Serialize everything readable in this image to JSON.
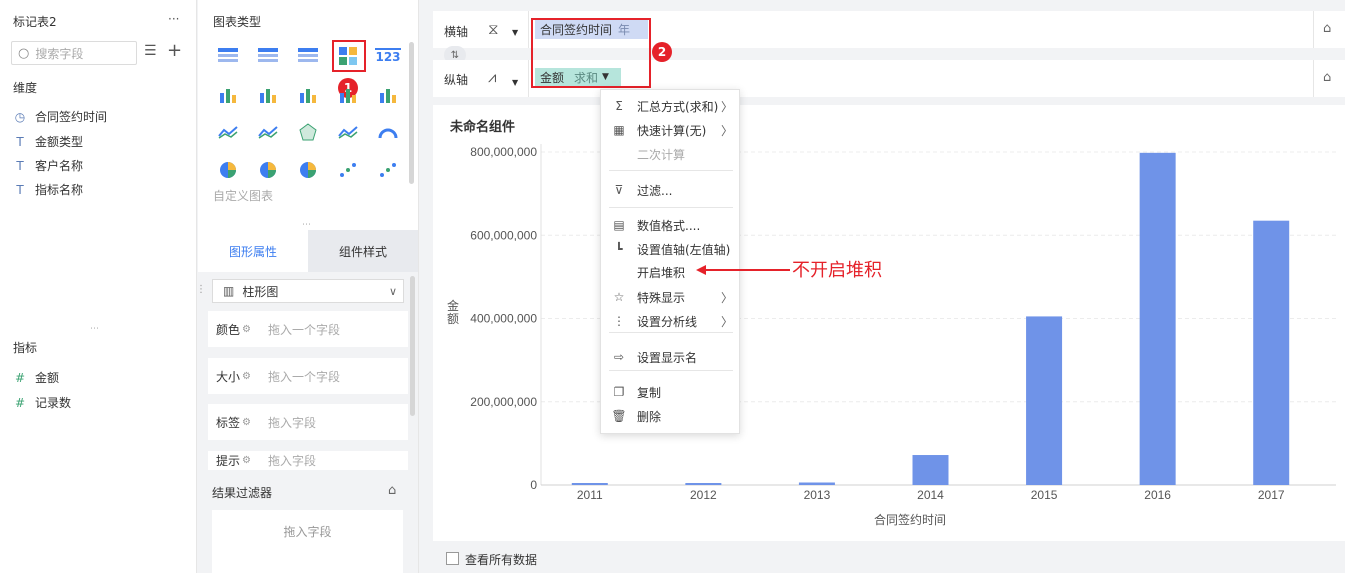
{
  "left": {
    "title": "标记表2",
    "more": "···",
    "search_placeholder": "搜索字段",
    "dimension_header": "维度",
    "dimensions": [
      {
        "icon": "clock-icon",
        "glyph": "◷",
        "label": "合同签约时间"
      },
      {
        "icon": "text-icon",
        "glyph": "T",
        "label": "金额类型"
      },
      {
        "icon": "text-icon",
        "glyph": "T",
        "label": "客户名称"
      },
      {
        "icon": "text-icon",
        "glyph": "T",
        "label": "指标名称"
      }
    ],
    "metric_header": "指标",
    "metrics": [
      {
        "icon": "hash-icon",
        "glyph": "#",
        "label": "金额"
      },
      {
        "icon": "hash-icon",
        "glyph": "#",
        "label": "记录数"
      }
    ]
  },
  "mid": {
    "chart_type_header": "图表类型",
    "custom_chart": "自定义图表",
    "tabs": [
      "图形属性",
      "组件样式"
    ],
    "chart_kind": "柱形图",
    "props": [
      {
        "label": "颜色",
        "placeholder": "拖入一个字段"
      },
      {
        "label": "大小",
        "placeholder": "拖入一个字段"
      },
      {
        "label": "标签",
        "placeholder": "拖入字段"
      },
      {
        "label": "提示",
        "placeholder": "拖入字段"
      }
    ],
    "result_filter": "结果过滤器",
    "drag_field": "拖入字段"
  },
  "axes": {
    "x_label": "横轴",
    "x_field": "合同签约时间",
    "x_field_tag": "年",
    "y_label": "纵轴",
    "y_field": "金额",
    "y_field_tag": "求和"
  },
  "badges": [
    "1",
    "2"
  ],
  "menu": {
    "items": [
      {
        "icon": "sigma-icon",
        "glyph": "Σ",
        "label": "汇总方式(求和)",
        "arrow": true,
        "disabled": false
      },
      {
        "icon": "quick-calc-icon",
        "glyph": "▦",
        "label": "快速计算(无)",
        "arrow": true,
        "disabled": false
      },
      {
        "icon": "",
        "glyph": "",
        "label": "二次计算",
        "arrow": false,
        "disabled": true
      },
      {
        "icon": "filter-icon",
        "glyph": "⊽",
        "label": "过滤...",
        "arrow": false,
        "disabled": false
      },
      {
        "icon": "number-format-icon",
        "glyph": "▤",
        "label": "数值格式....",
        "arrow": false,
        "disabled": false
      },
      {
        "icon": "value-axis-icon",
        "glyph": "┗",
        "label": "设置值轴(左值轴)",
        "arrow": false,
        "disabled": false
      },
      {
        "icon": "",
        "glyph": "",
        "label": "开启堆积",
        "arrow": false,
        "disabled": false
      },
      {
        "icon": "star-icon",
        "glyph": "☆",
        "label": "特殊显示",
        "arrow": true,
        "disabled": false
      },
      {
        "icon": "analysis-line-icon",
        "glyph": "⋮",
        "label": "设置分析线",
        "arrow": true,
        "disabled": false
      },
      {
        "icon": "display-name-icon",
        "glyph": "⇨",
        "label": "设置显示名",
        "arrow": false,
        "disabled": false
      },
      {
        "icon": "copy-icon",
        "glyph": "❐",
        "label": "复制",
        "arrow": false,
        "disabled": false
      },
      {
        "icon": "delete-icon",
        "glyph": "🗑",
        "label": "删除",
        "arrow": false,
        "disabled": false
      }
    ]
  },
  "annotation": "不开启堆积",
  "widget_title": "未命名组件",
  "view_all": "查看所有数据",
  "colors": {
    "bar": "#6f93e8",
    "accent": "#3d7ef0",
    "red": "#e5222a"
  },
  "chart_data": {
    "type": "bar",
    "title": "未命名组件",
    "xlabel": "合同签约时间",
    "ylabel": "金额",
    "categories": [
      "2011",
      "2012",
      "2013",
      "2014",
      "2015",
      "2016",
      "2017"
    ],
    "values": [
      1500000,
      2000000,
      6000000,
      72000000,
      405000000,
      798000000,
      635000000
    ],
    "y_ticks": [
      "800,000,000",
      "600,000,000",
      "400,000,000",
      "200,000,000",
      "0"
    ],
    "ylim": [
      0,
      800000000
    ],
    "grid": true
  }
}
